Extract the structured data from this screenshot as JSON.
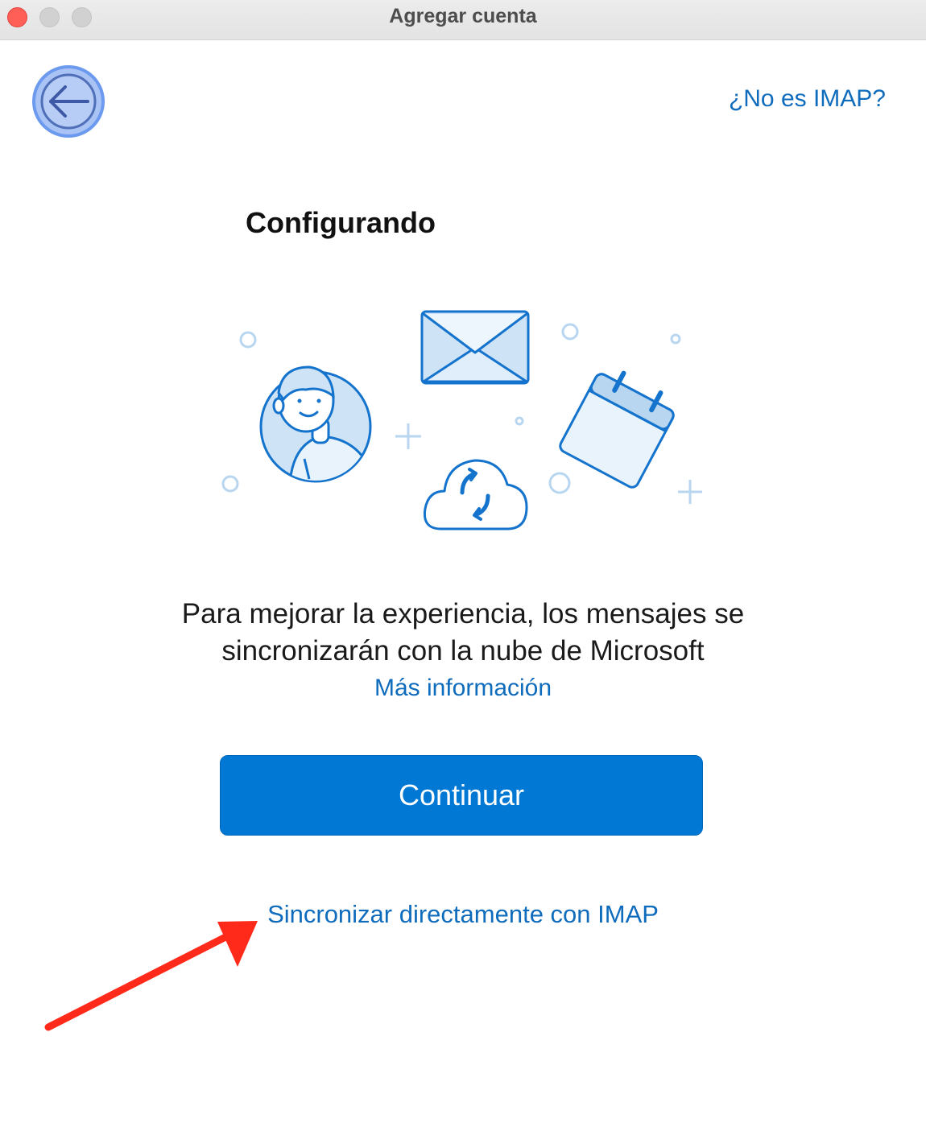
{
  "window": {
    "title": "Agregar cuenta"
  },
  "header": {
    "back_icon": "back-arrow-icon",
    "not_imap_label": "¿No es IMAP?"
  },
  "main": {
    "heading": "Configurando",
    "description_line1": "Para mejorar la experiencia, los mensajes se",
    "description_line2": "sincronizarán con la nube de Microsoft",
    "more_info_label": "Más información",
    "continue_label": "Continuar",
    "imap_sync_label": "Sincronizar directamente con IMAP"
  },
  "illustration": {
    "icons": [
      "user-avatar-icon",
      "envelope-icon",
      "calendar-icon",
      "cloud-sync-icon"
    ]
  },
  "annotation": {
    "arrow_icon": "red-arrow-icon",
    "arrow_color": "#ff2a1a"
  },
  "colors": {
    "accent": "#0078d4",
    "link": "#0f6cbd"
  }
}
